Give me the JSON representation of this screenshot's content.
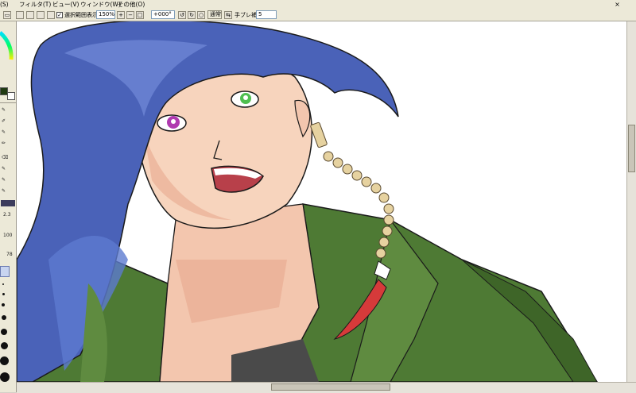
{
  "menu": {
    "items": [
      "(S)",
      "フィルタ(T)",
      "ビュー(V)",
      "ウィンドウ(W)",
      "その他(O)"
    ],
    "close_glyph": "×"
  },
  "toolbar": {
    "selection_checkbox_label": "選択範囲表示",
    "selection_checked": true,
    "zoom_value": "150%",
    "rotation_value": "+000°",
    "blend_mode": "通常",
    "stabilizer_label": "手ブレ補正",
    "stabilizer_value": "5"
  },
  "left_panel": {
    "brush_numbers": [
      "2.3",
      "100",
      "78"
    ],
    "size_labels": [
      "1",
      "2",
      "4",
      "8",
      "16",
      "25",
      "50",
      "100",
      "200",
      "300",
      "500"
    ],
    "primary_color": "#1f3a12",
    "secondary_color": "#ffffff"
  },
  "canvas": {
    "art_subject": "anime-character-illustration",
    "colors": {
      "hair": "#4a62b8",
      "skin": "#f3c6ae",
      "jacket": "#4e7a34",
      "tassel": "#d63a3a",
      "beads": "#e6d2a0"
    }
  },
  "icons": [
    "close-icon",
    "selection-icon",
    "zoom-in-icon",
    "zoom-out-icon",
    "rotate-left-icon",
    "rotate-right-icon",
    "reset-icon",
    "color-wheel-icon",
    "brush-icon",
    "pen-icon",
    "eraser-icon"
  ]
}
